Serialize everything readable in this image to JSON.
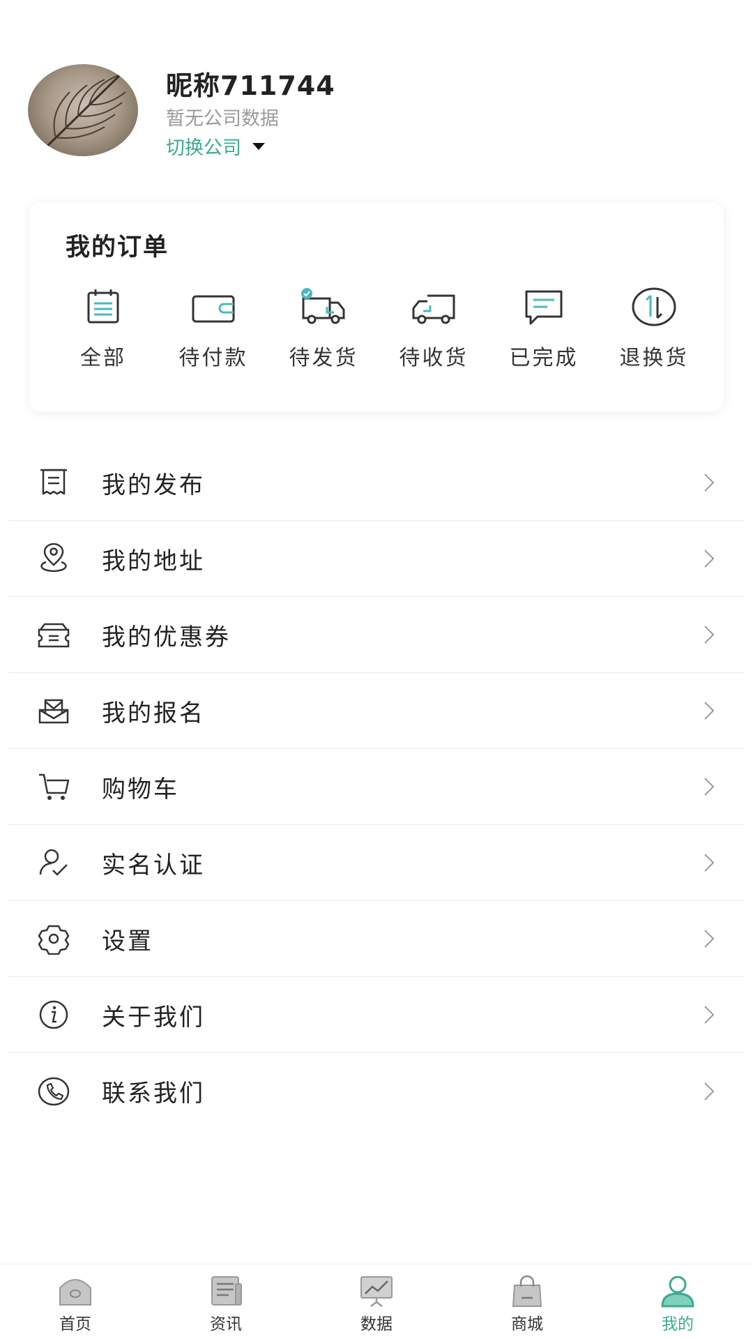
{
  "profile": {
    "nickname": "昵称711744",
    "company_status": "暂无公司数据",
    "switch_company": "切换公司"
  },
  "orders": {
    "title": "我的订单",
    "items": [
      {
        "label": "全部",
        "icon": "calendar-list-icon"
      },
      {
        "label": "待付款",
        "icon": "wallet-icon"
      },
      {
        "label": "待发货",
        "icon": "truck-check-icon"
      },
      {
        "label": "待收货",
        "icon": "truck-icon"
      },
      {
        "label": "已完成",
        "icon": "message-icon"
      },
      {
        "label": "退换货",
        "icon": "exchange-icon"
      }
    ]
  },
  "menu": [
    {
      "label": "我的发布",
      "icon": "receipt-icon"
    },
    {
      "label": "我的地址",
      "icon": "location-icon"
    },
    {
      "label": "我的优惠券",
      "icon": "coupon-icon"
    },
    {
      "label": "我的报名",
      "icon": "mail-tray-icon"
    },
    {
      "label": "购物车",
      "icon": "cart-icon"
    },
    {
      "label": "实名认证",
      "icon": "user-check-icon"
    },
    {
      "label": "设置",
      "icon": "gear-icon"
    },
    {
      "label": "关于我们",
      "icon": "info-icon"
    },
    {
      "label": "联系我们",
      "icon": "phone-icon"
    }
  ],
  "tabbar": [
    {
      "label": "首页",
      "icon": "home-icon",
      "active": false
    },
    {
      "label": "资讯",
      "icon": "news-icon",
      "active": false
    },
    {
      "label": "数据",
      "icon": "chart-icon",
      "active": false
    },
    {
      "label": "商城",
      "icon": "shopping-bag-icon",
      "active": false
    },
    {
      "label": "我的",
      "icon": "user-icon",
      "active": true
    }
  ],
  "colors": {
    "accent": "#3aab8f",
    "icon_teal": "#4bb8c0",
    "icon_dark": "#333333"
  }
}
